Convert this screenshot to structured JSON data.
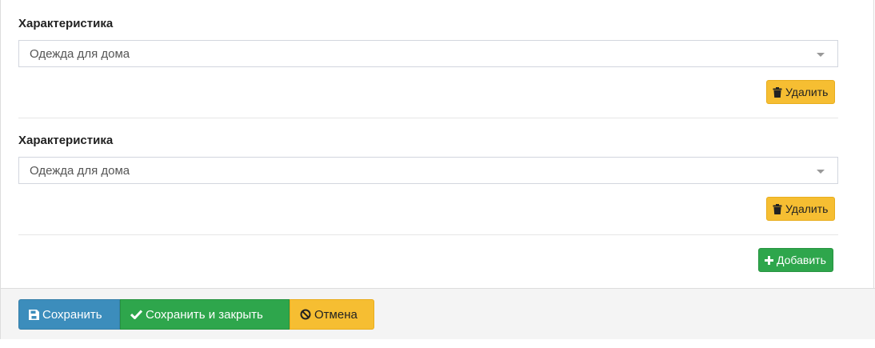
{
  "characteristics": [
    {
      "label": "Характеристика",
      "selected": "Одежда для дома",
      "delete_label": "Удалить"
    },
    {
      "label": "Характеристика",
      "selected": "Одежда для дома",
      "delete_label": "Удалить"
    }
  ],
  "add_label": "Добавить",
  "footer": {
    "save_label": "Сохранить",
    "save_close_label": "Сохранить и закрыть",
    "cancel_label": "Отмена"
  },
  "icons": {
    "delete": "trash-icon",
    "add": "plus-icon",
    "save": "floppy-disk-icon",
    "save_close": "check-icon",
    "cancel": "ban-icon"
  },
  "colors": {
    "warning": "#f6be32",
    "success": "#2ea64c",
    "primary": "#3c8dbc"
  }
}
